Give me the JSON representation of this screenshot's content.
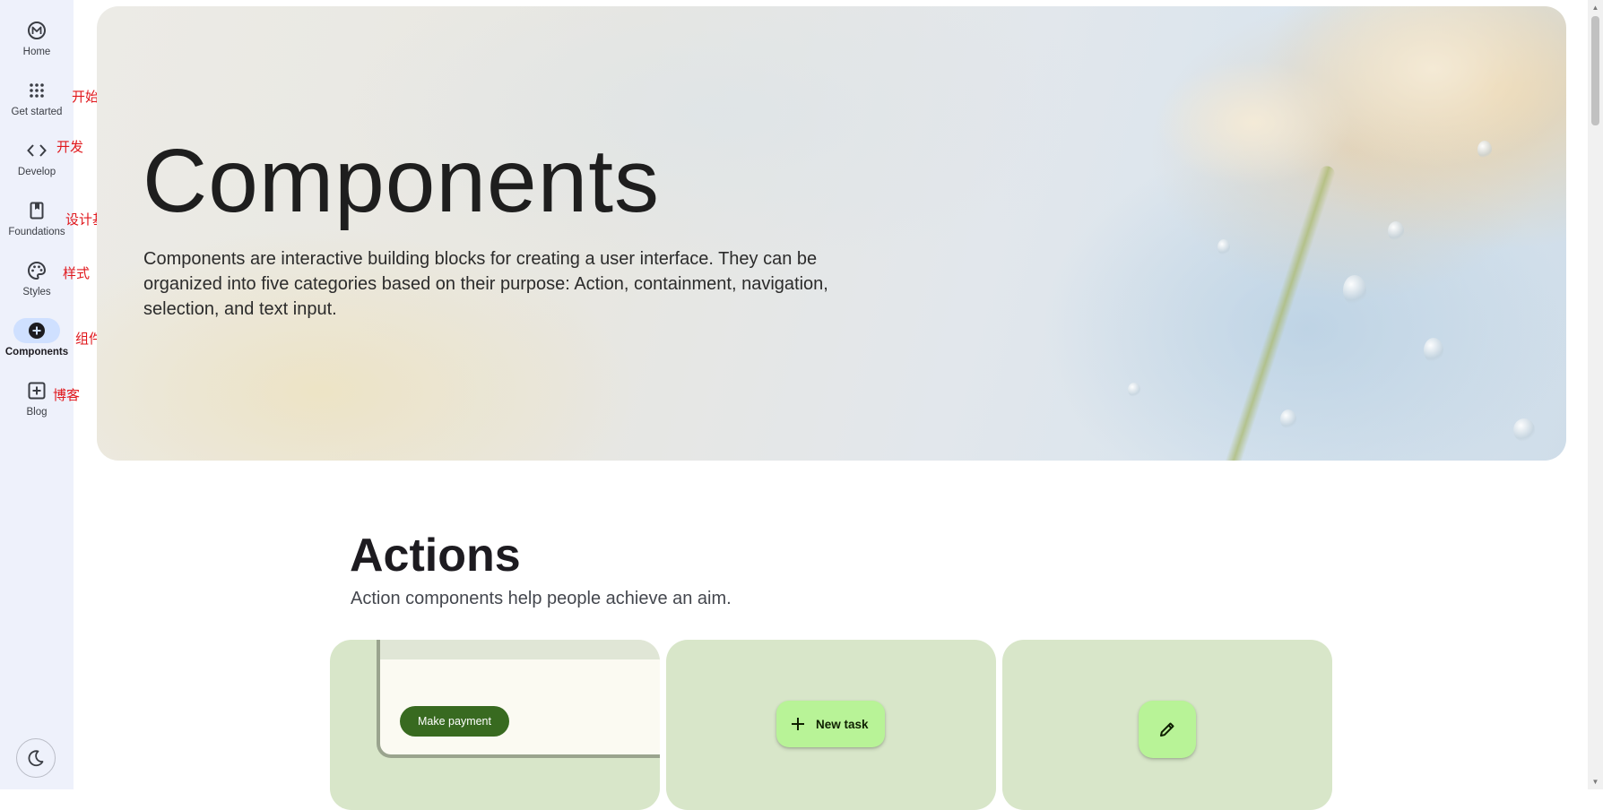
{
  "nav": {
    "items": [
      {
        "label": "Home",
        "icon": "m3-logo-icon",
        "annotation": ""
      },
      {
        "label": "Get started",
        "icon": "apps-grid-icon",
        "annotation": "开始"
      },
      {
        "label": "Develop",
        "icon": "code-brackets-icon",
        "annotation": "开发"
      },
      {
        "label": "Foundations",
        "icon": "book-icon",
        "annotation": "设计基础"
      },
      {
        "label": "Styles",
        "icon": "palette-icon",
        "annotation": "样式"
      },
      {
        "label": "Components",
        "icon": "add-circle-icon",
        "annotation": "组件",
        "active": true
      },
      {
        "label": "Blog",
        "icon": "add-box-icon",
        "annotation": "博客"
      }
    ],
    "theme_toggle_icon": "dark-mode-moon-icon"
  },
  "hero": {
    "title": "Components",
    "description": "Components are interactive building blocks for creating a user interface. They can be organized into five categories based on their purpose: Action, containment, navigation, selection, and text input."
  },
  "actions": {
    "title": "Actions",
    "description": "Action components help people achieve an aim.",
    "cards": [
      {
        "button_label": "Make payment"
      },
      {
        "button_label": "New task",
        "icon": "plus-icon"
      },
      {
        "icon": "pencil-icon"
      }
    ]
  },
  "colors": {
    "rail_bg": "#eef1fb",
    "active_pill": "#cfe0ff",
    "card_bg": "#d8e6c9",
    "fab_bg": "#b8f397",
    "primary_button": "#386a20",
    "annotation_red": "#e0171c"
  }
}
